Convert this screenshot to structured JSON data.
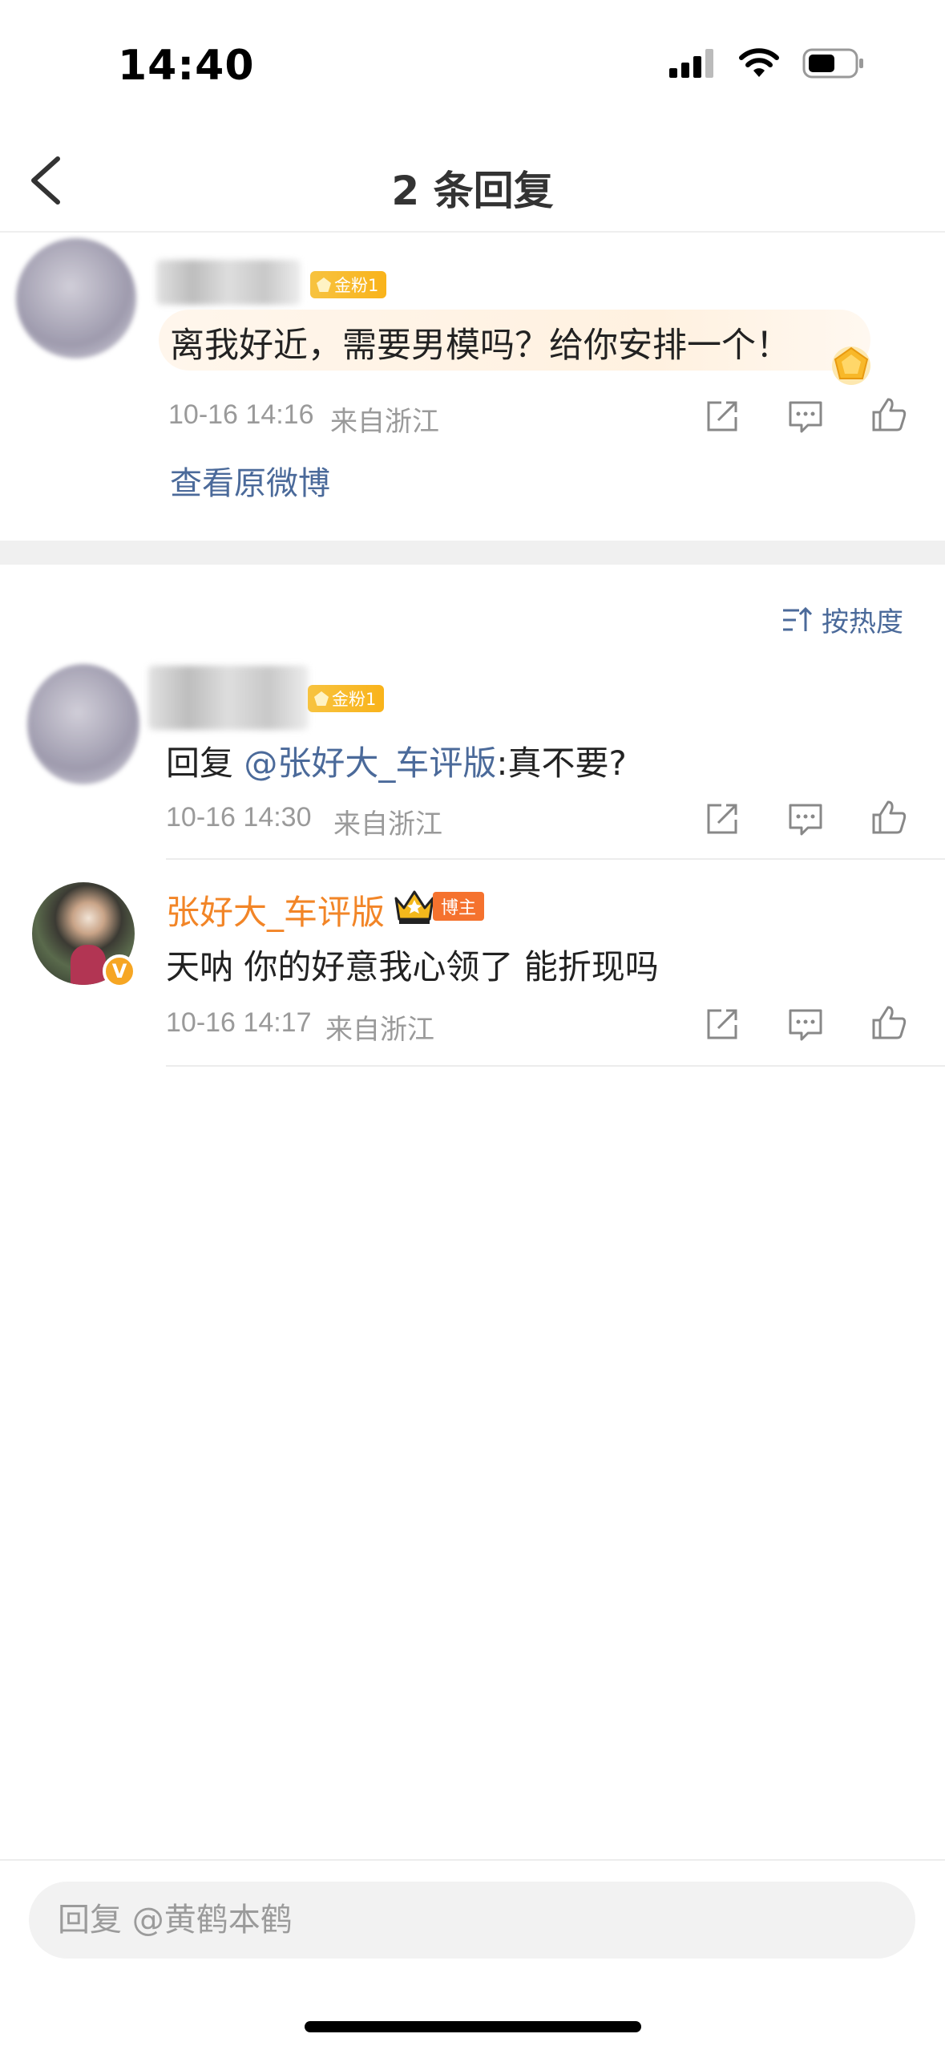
{
  "status": {
    "time": "14:40"
  },
  "nav": {
    "title": "2 条回复"
  },
  "original": {
    "badge": "金粉1",
    "text": "离我好近，需要男模吗？给你安排一个！",
    "time": "10-16 14:16",
    "location": "来自浙江",
    "view_original": "查看原微博"
  },
  "sort": {
    "label": "按热度"
  },
  "replies": [
    {
      "badge": "金粉1",
      "prefix": "回复 ",
      "mention": "@张好大_车评版",
      "text": ":真不要?",
      "time": "10-16 14:30",
      "location": "来自浙江"
    },
    {
      "name": "张好大_车评版",
      "role_badge": "博主",
      "text": "天呐 你的好意我心领了 能折现吗",
      "time": "10-16 14:17",
      "location": "来自浙江"
    }
  ],
  "input": {
    "placeholder": "回复 @黄鹤本鹤"
  },
  "colors": {
    "link": "#4b6a9a",
    "blogger_name": "#f28527",
    "badge_gold": "#f9b31a",
    "badge_orange": "#f5722e"
  }
}
